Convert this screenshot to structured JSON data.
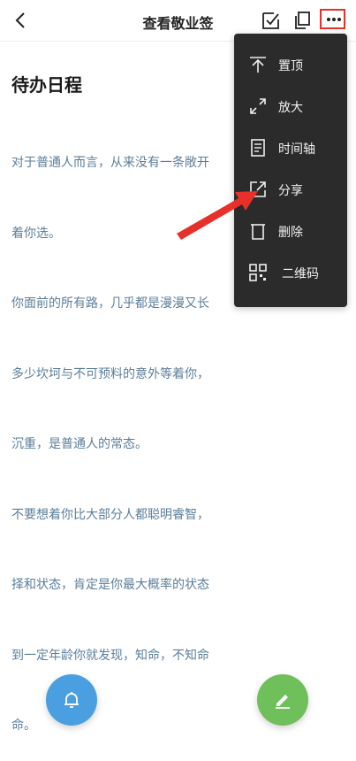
{
  "header": {
    "title": "查看敬业签"
  },
  "note": {
    "title": "待办日程",
    "lines": [
      "对于普通人而言，从来没有一条敞开",
      "着你选。",
      "你面前的所有路，几乎都是漫漫又长",
      "多少坎坷与不可预料的意外等着你，",
      "沉重，是普通人的常态。",
      "不要想着你比大部分人都聪明睿智，",
      "择和状态，肯定是你最大概率的状态",
      "到一定年龄你就发现，知命，不知命",
      "命。"
    ]
  },
  "menu": {
    "items": [
      {
        "label": "置顶",
        "icon": "pin-top-icon"
      },
      {
        "label": "放大",
        "icon": "expand-icon"
      },
      {
        "label": "时间轴",
        "icon": "timeline-icon"
      },
      {
        "label": "分享",
        "icon": "share-icon"
      },
      {
        "label": "删除",
        "icon": "trash-icon"
      },
      {
        "label": "二维码",
        "icon": "qr-code-icon"
      }
    ]
  },
  "colors": {
    "accent_red": "#e8302a",
    "body_text": "#5b7e9a",
    "menu_bg": "#2b2b2b",
    "fab_blue": "#4a9fe0",
    "fab_green": "#6fbf5a"
  }
}
